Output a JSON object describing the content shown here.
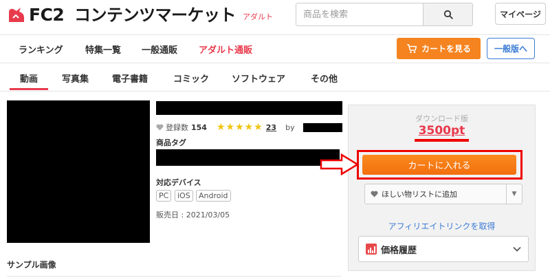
{
  "header": {
    "logo_primary": "FC2",
    "logo_secondary": "コンテンツマーケット",
    "logo_badge": "アダルト",
    "search_placeholder": "商品を検索",
    "mypage_label": "マイページ"
  },
  "nav_primary": {
    "items": [
      "ランキング",
      "特集一覧",
      "一般通販",
      "アダルト通販"
    ],
    "cart_label": "カートを見る",
    "general_label": "一般版へ"
  },
  "nav_categories": {
    "items": [
      "動画",
      "写真集",
      "電子書籍",
      "コミック",
      "ソフトウェア",
      "その他"
    ],
    "active": "動画"
  },
  "product": {
    "favorites_label": "登録数",
    "favorites_count": "154",
    "rating": 5,
    "review_count": "23",
    "by_label": "by",
    "tags_heading": "商品タグ",
    "devices_heading": "対応デバイス",
    "devices": [
      "PC",
      "iOS",
      "Android"
    ],
    "release_date": "販売日 : 2021/03/05",
    "sample_heading": "サンプル画像"
  },
  "purchase": {
    "edition_label": "ダウンロード版",
    "price": "3500pt",
    "add_to_cart_label": "カートに入れる",
    "wishlist_label": "ほしい物リストに追加",
    "affiliate_label": "アフィリエイトリンクを取得",
    "price_history_label": "価格履歴"
  },
  "colors": {
    "accent_red": "#e83a4c",
    "orange": "#f5831f",
    "link_blue": "#3a7bd5",
    "highlight_red": "#ee0000"
  }
}
